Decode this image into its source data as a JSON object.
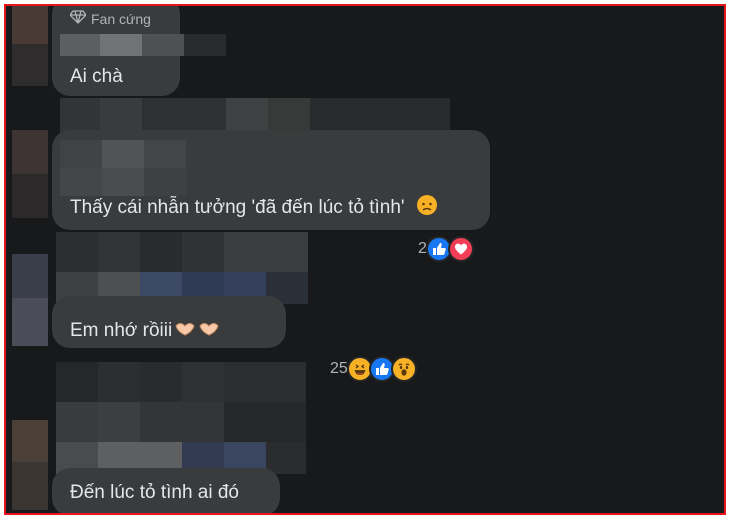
{
  "comments": [
    {
      "badge": "Fan cứng",
      "text": "Ai chà"
    },
    {
      "text": "Thấy cái nhẫn tưởng 'đã đến lúc tỏ tình'",
      "reaction_count": "2"
    },
    {
      "text": "Em nhớ rồiii",
      "reaction_count": "25"
    },
    {
      "text": "Đến lúc tỏ tình ai đó"
    }
  ],
  "icons": {
    "badge": "diamond-icon",
    "sad": "sad-face-icon",
    "like": "like-icon",
    "love": "love-icon",
    "haha": "haha-icon",
    "wow": "wow-icon",
    "hands": "heart-hands-icon"
  },
  "colors": {
    "frame_border": "#e8141b",
    "background": "#18191a",
    "bubble": "#3a3b3c",
    "text": "#e4e6eb",
    "muted": "#b0b3b8",
    "like": "#1877f2",
    "love": "#f33e58",
    "emoji": "#f7b125"
  }
}
